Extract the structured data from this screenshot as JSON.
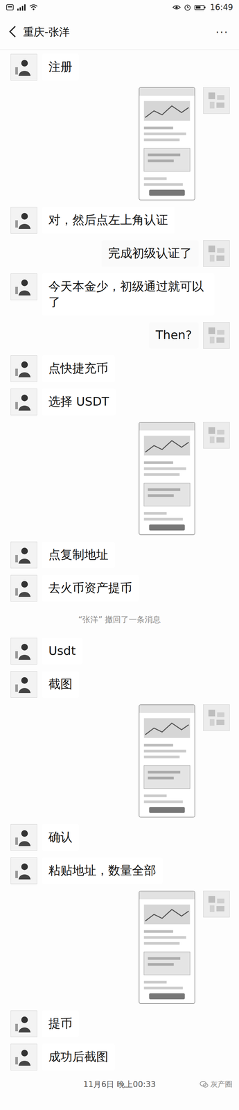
{
  "status_bar": {
    "time": "16:49"
  },
  "header": {
    "title": "重庆-张洋",
    "more": "···"
  },
  "messages": [
    {
      "kind": "text",
      "from": "them",
      "text": "注册"
    },
    {
      "kind": "image",
      "from": "me"
    },
    {
      "kind": "text",
      "from": "them",
      "text": "对，然后点左上角认证"
    },
    {
      "kind": "text",
      "from": "me",
      "text": "完成初级认证了"
    },
    {
      "kind": "text",
      "from": "them",
      "text": "今天本金少，初级通过就可以了"
    },
    {
      "kind": "text",
      "from": "me",
      "text": "Then?"
    },
    {
      "kind": "text",
      "from": "them",
      "text": "点快捷充币"
    },
    {
      "kind": "text",
      "from": "them",
      "text": "选择 USDT"
    },
    {
      "kind": "image",
      "from": "me"
    },
    {
      "kind": "text",
      "from": "them",
      "text": "点复制地址"
    },
    {
      "kind": "text",
      "from": "them",
      "text": "去火币资产提币"
    },
    {
      "kind": "system",
      "text": "“张洋” 撤回了一条消息"
    },
    {
      "kind": "text",
      "from": "them",
      "text": "Usdt"
    },
    {
      "kind": "text",
      "from": "them",
      "text": "截图"
    },
    {
      "kind": "image",
      "from": "me"
    },
    {
      "kind": "text",
      "from": "them",
      "text": "确认"
    },
    {
      "kind": "text",
      "from": "them",
      "text": "粘贴地址，数量全部"
    },
    {
      "kind": "image",
      "from": "me"
    },
    {
      "kind": "text",
      "from": "them",
      "text": "提币"
    },
    {
      "kind": "text",
      "from": "them",
      "text": "成功后截图"
    }
  ],
  "footer": {
    "timestamp": "11月6日 晚上00:33",
    "watermark": "灰产圈"
  }
}
